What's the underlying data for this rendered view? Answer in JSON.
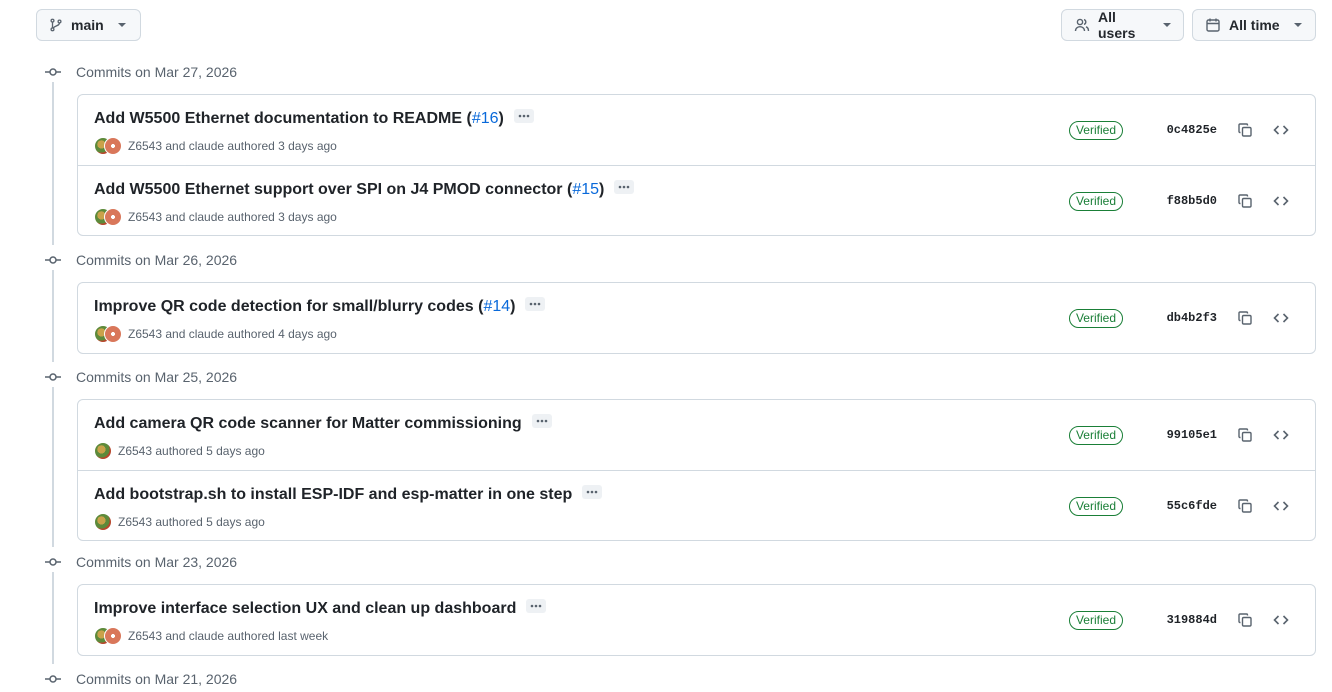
{
  "header": {
    "branch_label": "main",
    "users_label": "All users",
    "time_label": "All time"
  },
  "groups": [
    {
      "heading": "Commits on Mar 27, 2026",
      "commits": [
        {
          "title": "Add W5500 Ethernet documentation to README",
          "pr": "#16",
          "authors": "Z6543 and claude",
          "author_suffix": "authored 3 days ago",
          "verified": "Verified",
          "sha": "0c4825e",
          "dual_avatar": true
        },
        {
          "title": "Add W5500 Ethernet support over SPI on J4 PMOD connector",
          "pr": "#15",
          "authors": "Z6543 and claude",
          "author_suffix": "authored 3 days ago",
          "verified": "Verified",
          "sha": "f88b5d0",
          "dual_avatar": true
        }
      ]
    },
    {
      "heading": "Commits on Mar 26, 2026",
      "commits": [
        {
          "title": "Improve QR code detection for small/blurry codes",
          "pr": "#14",
          "authors": "Z6543 and claude",
          "author_suffix": "authored 4 days ago",
          "verified": "Verified",
          "sha": "db4b2f3",
          "dual_avatar": true
        }
      ]
    },
    {
      "heading": "Commits on Mar 25, 2026",
      "commits": [
        {
          "title": "Add camera QR code scanner for Matter commissioning",
          "pr": "",
          "authors": "Z6543",
          "author_suffix": "authored 5 days ago",
          "verified": "Verified",
          "sha": "99105e1",
          "dual_avatar": false
        },
        {
          "title": "Add bootstrap.sh to install ESP-IDF and esp-matter in one step",
          "pr": "",
          "authors": "Z6543",
          "author_suffix": "authored 5 days ago",
          "verified": "Verified",
          "sha": "55c6fde",
          "dual_avatar": false
        }
      ]
    },
    {
      "heading": "Commits on Mar 23, 2026",
      "commits": [
        {
          "title": "Improve interface selection UX and clean up dashboard",
          "pr": "",
          "authors": "Z6543 and claude",
          "author_suffix": "authored last week",
          "verified": "Verified",
          "sha": "319884d",
          "dual_avatar": true
        }
      ]
    },
    {
      "heading": "Commits on Mar 21, 2026",
      "commits": []
    }
  ]
}
